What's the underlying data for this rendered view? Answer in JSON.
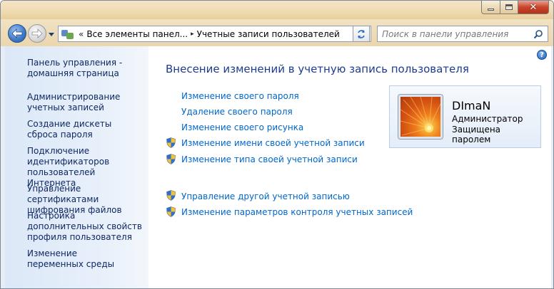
{
  "window": {
    "caption_buttons": [
      "minimize-icon",
      "maximize-icon",
      "close-icon"
    ]
  },
  "navbar": {
    "back_icon": "back-arrow-icon",
    "forward_icon": "forward-arrow-icon",
    "address": {
      "prefix": "«",
      "crumbs": [
        "Все элементы панел...",
        "Учетные записи пользователей"
      ],
      "separator": "▸"
    },
    "search": {
      "placeholder": "Поиск в панели управления"
    }
  },
  "sidebar": {
    "items": [
      {
        "label": "Панель управления - домашняя страница"
      },
      {
        "label": "Администрирование учетных записей"
      },
      {
        "label": "Создание дискеты сброса пароля"
      },
      {
        "label": "Подключение идентификаторов пользователей Интернета"
      },
      {
        "label": "Управление сертификатами шифрования файлов"
      },
      {
        "label": "Настройка дополнительных свойств профиля пользователя"
      },
      {
        "label": "Изменение переменных среды"
      }
    ]
  },
  "main": {
    "title": "Внесение изменений в учетную запись пользователя",
    "tasks": [
      {
        "label": "Изменение своего пароля",
        "shield": false
      },
      {
        "label": "Удаление своего пароля",
        "shield": false
      },
      {
        "label": "Изменение своего рисунка",
        "shield": false
      },
      {
        "label": "Изменение имени своей учетной записи",
        "shield": true
      },
      {
        "label": "Изменение типа своей учетной записи",
        "shield": true
      }
    ],
    "tasks2": [
      {
        "label": "Управление другой учетной записью",
        "shield": true
      },
      {
        "label": "Изменение параметров контроля учетных записей",
        "shield": true
      }
    ],
    "help_icon": "?"
  },
  "user": {
    "name": "DImaN",
    "role": "Администратор",
    "status": "Защищена паролем"
  },
  "colors": {
    "link": "#0066cc",
    "title": "#1d3b8f",
    "sidebar_link": "#0e2860",
    "titlebar": "#f1ddb6"
  }
}
